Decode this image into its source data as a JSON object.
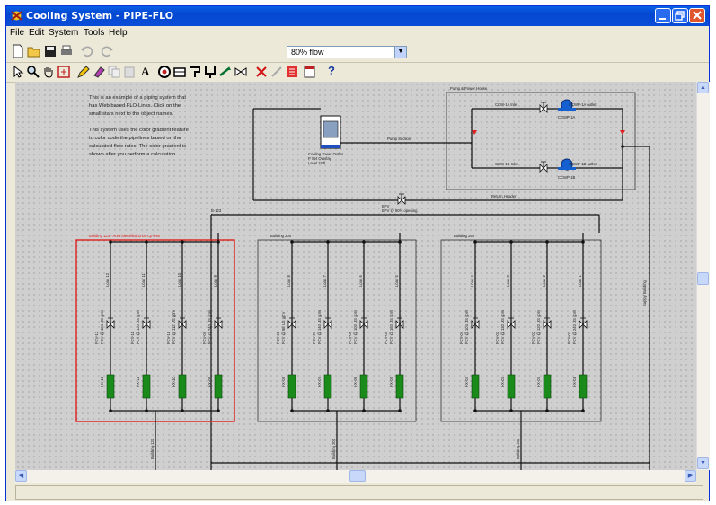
{
  "window": {
    "title": "Cooling System - PIPE-FLO"
  },
  "menu": [
    "File",
    "Edit",
    "System",
    "Tools",
    "Help"
  ],
  "toolbar": {
    "flow_select": "80% flow",
    "text_tool": "A",
    "help": "?"
  },
  "notes": [
    "This is an example of a piping system that",
    "has Web based FLO-Links. Click on the",
    "small stars next to the object names.",
    "",
    "This system uses the color gradient feature",
    "to color code the pipelines based on the",
    "calculated flow rates. The color gradient is",
    "shown after you perform a calculation."
  ],
  "colors": {
    "title_bar": "#0447d0",
    "canvas": "#cfcfcf",
    "exchanger": "#1a8a1a",
    "highlight": "#e02020",
    "pump": "#1560d0"
  },
  "diagram": {
    "pump_house_label": "Pump & Power House",
    "tower_label": [
      "Cooling Tower Outlet",
      "P Set Overlay",
      "Level 15 ft"
    ],
    "pump_suction": "Pump Suction",
    "return_header": "Return Header",
    "bypass_label": [
      "BPV",
      "BPV @ 80% opening"
    ],
    "supply_label": "Supply Building",
    "top_pump": {
      "name": "CCWP-1A",
      "in": "CCW-1A Inlet",
      "out": "CCWP-1A outlet"
    },
    "bottom_pump": {
      "name": "CCWP-1B",
      "in": "CCW-1B Inlet",
      "out": "CCWP-1B outlet"
    },
    "b123_tag": "B-123",
    "buildings": [
      {
        "title": "Building 123 - Area identified to be Cp less",
        "bottom": "Building 123",
        "loads": [
          "Load 12",
          "Load 11",
          "Load 10",
          "Load 9"
        ],
        "fcvs": [
          "FCV-12 FCV @ 184 US gpm",
          "FCV-11 FCV @ 120 US gpm",
          "FCV-10 FCV @ 112 US gpm",
          "FCV-09 FCV @ 240 US gpm"
        ],
        "hx": [
          "HX-12",
          "HX-11",
          "HX-10",
          "HX-09"
        ]
      },
      {
        "title": "Building 200",
        "bottom": "Building 200",
        "loads": [
          "Load 8",
          "Load 7",
          "Load 6",
          "Load 5"
        ],
        "fcvs": [
          "FCV-08 FCV @ 98 US gpm",
          "FCV-07 FCV @ 140 US gpm",
          "FCV-06 FCV @ 100 US gpm",
          "FCV-05 FCV @ 160 US gpm"
        ],
        "hx": [
          "HX-08",
          "HX-07",
          "HX-06",
          "HX-05"
        ]
      },
      {
        "title": "Building 250",
        "bottom": "Building 250",
        "loads": [
          "Load 4",
          "Load 3",
          "Load 2",
          "Load 1"
        ],
        "fcvs": [
          "FCV-04 FCV @ 104 US gpm",
          "FCV-03 FCV @ 120 US gpm",
          "FCV-02 FCV @ 120 US gpm",
          "FCV-01 FCV @ 240 US gpm"
        ],
        "hx": [
          "HX-04",
          "HX-03",
          "HX-02",
          "HX-01"
        ]
      }
    ]
  }
}
